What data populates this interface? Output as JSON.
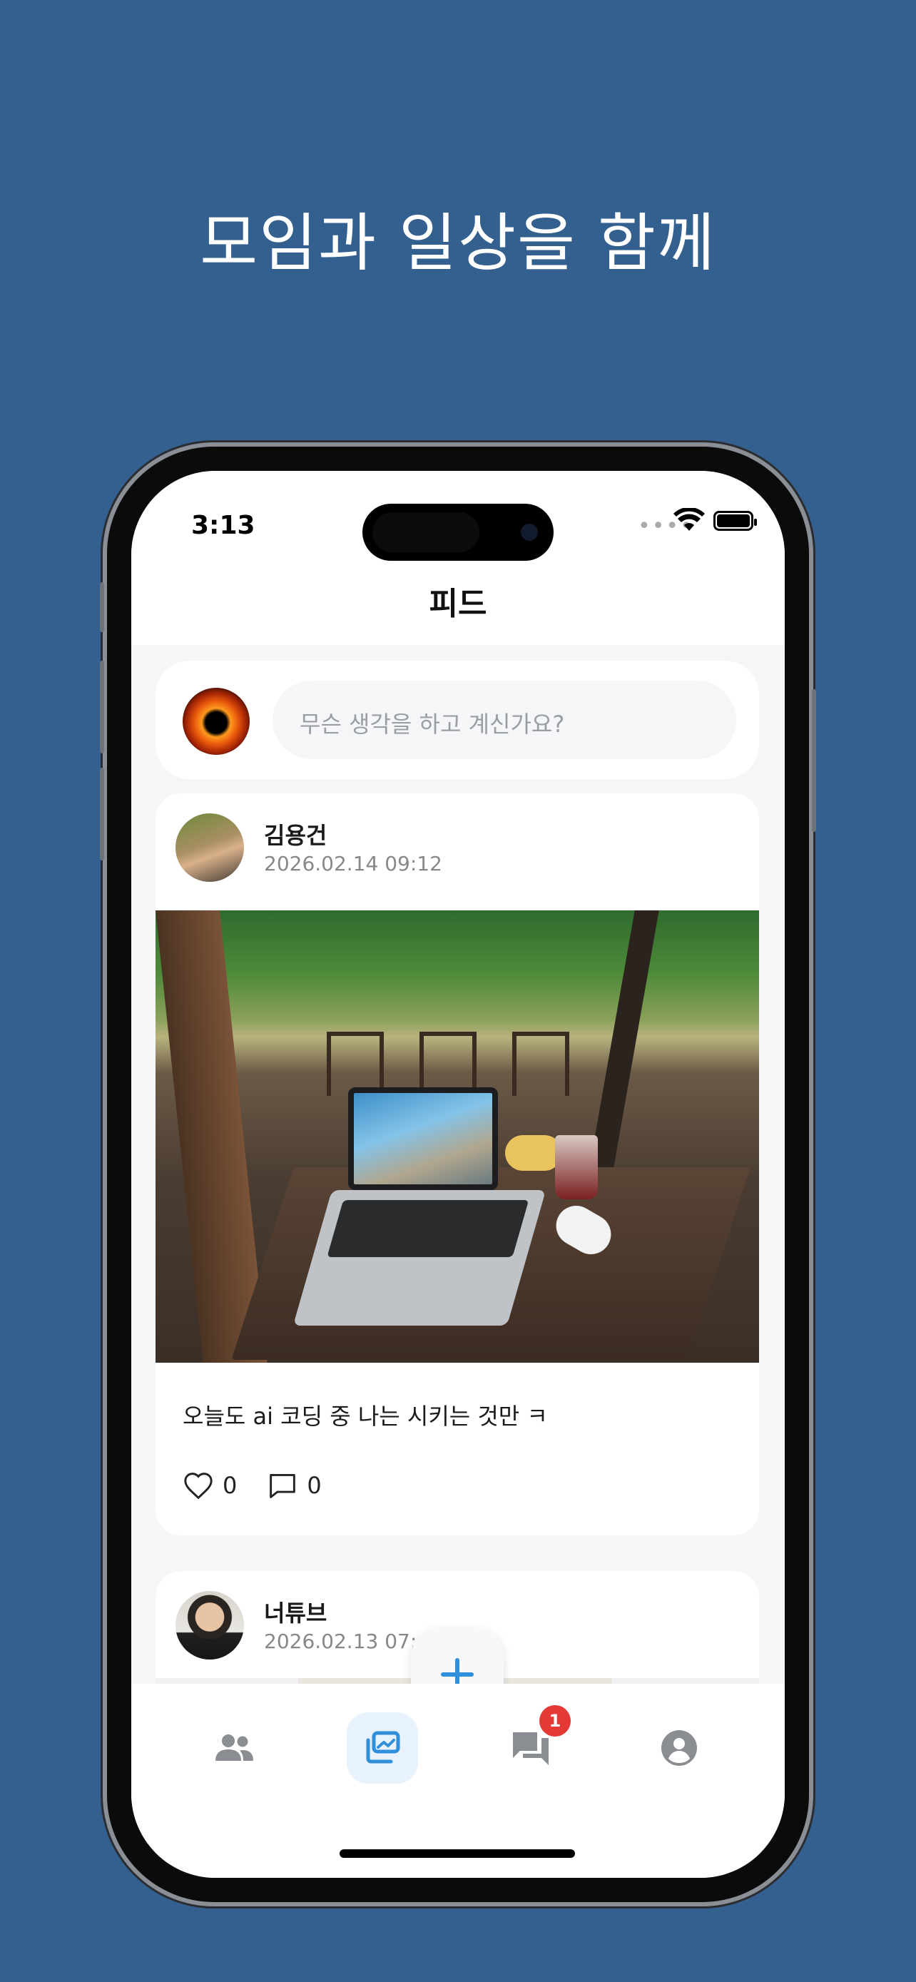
{
  "marketing": {
    "headline": "모임과 일상을 함께"
  },
  "status_bar": {
    "time": "3:13",
    "signal": "••••"
  },
  "nav": {
    "title": "피드"
  },
  "composer": {
    "placeholder": "무슨 생각을 하고 계신가요?"
  },
  "posts": [
    {
      "author": "김용건",
      "date": "2026.02.14 09:12",
      "caption": "오늘도 ai 코딩 중 나는 시키는 것만 ㅋ",
      "likes": "0",
      "comments": "0"
    },
    {
      "author": "너튜브",
      "date": "2026.02.13 07:"
    }
  ],
  "tabbar": {
    "items": [
      {
        "icon": "people-icon"
      },
      {
        "icon": "feed-icon",
        "active": true
      },
      {
        "icon": "chat-icon",
        "badge": "1"
      },
      {
        "icon": "profile-icon"
      }
    ]
  },
  "colors": {
    "background": "#34608f",
    "accent": "#2f8fdb",
    "badge": "#e53935"
  }
}
